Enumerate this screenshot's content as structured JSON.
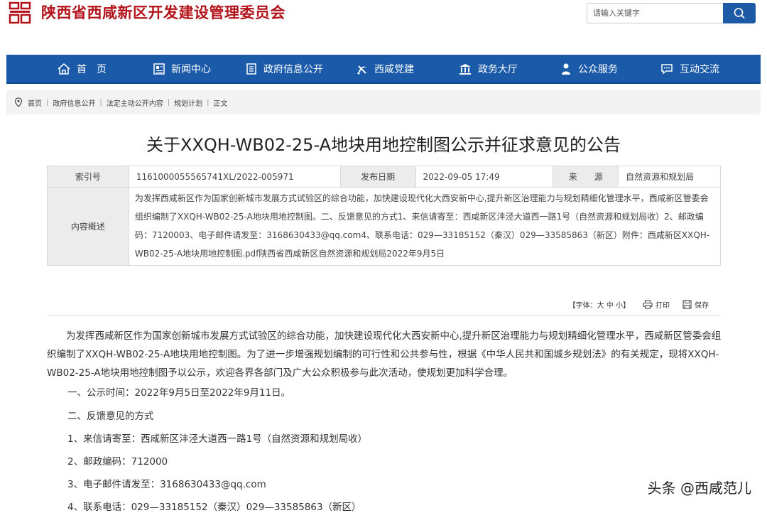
{
  "header": {
    "site_title": "陕西省西咸新区开发建设管理委员会",
    "search_placeholder": "请输入关键字"
  },
  "colors": {
    "brand_red": "#b3121b",
    "nav_blue": "#1a5aa8",
    "search_blue": "#1c5aa6"
  },
  "nav": [
    {
      "label": "首　页",
      "icon": "home-icon"
    },
    {
      "label": "新闻中心",
      "icon": "newspaper-icon"
    },
    {
      "label": "政府信息公开",
      "icon": "document-list-icon"
    },
    {
      "label": "西咸党建",
      "icon": "party-emblem-icon"
    },
    {
      "label": "政务大厅",
      "icon": "government-building-icon"
    },
    {
      "label": "公众服务",
      "icon": "user-service-icon"
    },
    {
      "label": "互动交流",
      "icon": "chat-bubble-icon"
    }
  ],
  "breadcrumb": [
    "首页",
    "政府信息公开",
    "法定主动公开内容",
    "规划计划",
    "正文"
  ],
  "article": {
    "title": "关于XXQH-WB02-25-A地块用地控制图公示并征求意见的公告",
    "meta": {
      "index_label": "索引号",
      "index_value": "1161000055565741XL/2022-005971",
      "date_label": "发布日期",
      "date_value": "2022-09-05 17:49",
      "source_label": "来　　源",
      "source_value": "自然资源和规划局",
      "summary_label": "内容概述",
      "summary_value": "为发挥西咸新区作为国家创新城市发展方式试验区的综合功能，加快建设现代化大西安新中心,提升新区治理能力与规划精细化管理水平，西咸新区管委会组织编制了XXQH-WB02-25-A地块用地控制图。二、反馈意见的方式1、来信请寄至：西咸新区沣泾大道西一路1号（自然资源和规划局收）2、邮政编码：7120003、电子邮件请发至：3168630433@qq.com4、联系电话：029—33185152（秦汉）029—33585863（新区）附件：西咸新区XXQH-WB02-25-A地块用地控制图.pdf陕西省西咸新区自然资源和规划局2022年9月5日"
    },
    "tools": {
      "font": "【字体：大 中 小】",
      "print": "打印",
      "save": "保存"
    },
    "intro": "为发挥西咸新区作为国家创新城市发展方式试验区的综合功能，加快建设现代化大西安新中心,提升新区治理能力与规划精细化管理水平，西咸新区管委会组织编制了XXQH-WB02-25-A地块用地控制图。为了进一步增强规划编制的可行性和公共参与性，根据《中华人民共和国城乡规划法》的有关规定，现将XXQH-WB02-25-A地块用地控制图予以公示，欢迎各界各部门及广大公众积极参与此次活动，使规划更加科学合理。",
    "lines": [
      "一、公示时间：2022年9月5日至2022年9月11日。",
      "二、反馈意见的方式",
      "1、来信请寄至：西咸新区沣泾大道西一路1号（自然资源和规划局收）",
      "2、邮政编码：712000",
      "3、电子邮件请发至：3168630433@qq.com",
      "4、联系电话：029—33185152（秦汉）029—33585863（新区）"
    ]
  },
  "watermark": "头条 @西咸范儿"
}
